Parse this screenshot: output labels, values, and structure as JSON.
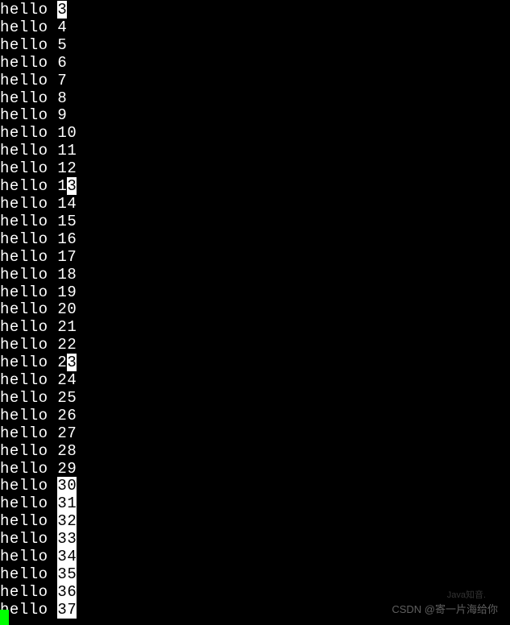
{
  "terminal": {
    "lines": [
      {
        "prefix": "hello ",
        "num": "3",
        "highlight_full": true,
        "highlight_partial": false
      },
      {
        "prefix": "hello ",
        "num": "4",
        "highlight_full": false,
        "highlight_partial": false
      },
      {
        "prefix": "hello ",
        "num": "5",
        "highlight_full": false,
        "highlight_partial": false
      },
      {
        "prefix": "hello ",
        "num": "6",
        "highlight_full": false,
        "highlight_partial": false
      },
      {
        "prefix": "hello ",
        "num": "7",
        "highlight_full": false,
        "highlight_partial": false
      },
      {
        "prefix": "hello ",
        "num": "8",
        "highlight_full": false,
        "highlight_partial": false
      },
      {
        "prefix": "hello ",
        "num": "9",
        "highlight_full": false,
        "highlight_partial": false
      },
      {
        "prefix": "hello ",
        "num": "10",
        "highlight_full": false,
        "highlight_partial": false
      },
      {
        "prefix": "hello ",
        "num": "11",
        "highlight_full": false,
        "highlight_partial": false
      },
      {
        "prefix": "hello ",
        "num": "12",
        "highlight_full": false,
        "highlight_partial": false
      },
      {
        "prefix": "hello ",
        "num": "13",
        "highlight_full": false,
        "highlight_partial": true,
        "pre_digit": "1",
        "hl_digit": "3"
      },
      {
        "prefix": "hello ",
        "num": "14",
        "highlight_full": false,
        "highlight_partial": false
      },
      {
        "prefix": "hello ",
        "num": "15",
        "highlight_full": false,
        "highlight_partial": false
      },
      {
        "prefix": "hello ",
        "num": "16",
        "highlight_full": false,
        "highlight_partial": false
      },
      {
        "prefix": "hello ",
        "num": "17",
        "highlight_full": false,
        "highlight_partial": false
      },
      {
        "prefix": "hello ",
        "num": "18",
        "highlight_full": false,
        "highlight_partial": false
      },
      {
        "prefix": "hello ",
        "num": "19",
        "highlight_full": false,
        "highlight_partial": false
      },
      {
        "prefix": "hello ",
        "num": "20",
        "highlight_full": false,
        "highlight_partial": false
      },
      {
        "prefix": "hello ",
        "num": "21",
        "highlight_full": false,
        "highlight_partial": false
      },
      {
        "prefix": "hello ",
        "num": "22",
        "highlight_full": false,
        "highlight_partial": false
      },
      {
        "prefix": "hello ",
        "num": "23",
        "highlight_full": false,
        "highlight_partial": true,
        "pre_digit": "2",
        "hl_digit": "3"
      },
      {
        "prefix": "hello ",
        "num": "24",
        "highlight_full": false,
        "highlight_partial": false
      },
      {
        "prefix": "hello ",
        "num": "25",
        "highlight_full": false,
        "highlight_partial": false
      },
      {
        "prefix": "hello ",
        "num": "26",
        "highlight_full": false,
        "highlight_partial": false
      },
      {
        "prefix": "hello ",
        "num": "27",
        "highlight_full": false,
        "highlight_partial": false
      },
      {
        "prefix": "hello ",
        "num": "28",
        "highlight_full": false,
        "highlight_partial": false
      },
      {
        "prefix": "hello ",
        "num": "29",
        "highlight_full": false,
        "highlight_partial": false
      },
      {
        "prefix": "hello ",
        "num": "30",
        "highlight_full": true,
        "highlight_partial": false
      },
      {
        "prefix": "hello ",
        "num": "31",
        "highlight_full": true,
        "highlight_partial": false
      },
      {
        "prefix": "hello ",
        "num": "32",
        "highlight_full": true,
        "highlight_partial": false
      },
      {
        "prefix": "hello ",
        "num": "33",
        "highlight_full": true,
        "highlight_partial": false
      },
      {
        "prefix": "hello ",
        "num": "34",
        "highlight_full": true,
        "highlight_partial": false
      },
      {
        "prefix": "hello ",
        "num": "35",
        "highlight_full": true,
        "highlight_partial": false
      },
      {
        "prefix": "hello ",
        "num": "36",
        "highlight_full": true,
        "highlight_partial": false
      },
      {
        "prefix": "hello ",
        "num": "37",
        "highlight_full": true,
        "highlight_partial": false
      }
    ]
  },
  "watermark": {
    "main": "CSDN @寄一片海给你",
    "sub": "Java知音."
  }
}
